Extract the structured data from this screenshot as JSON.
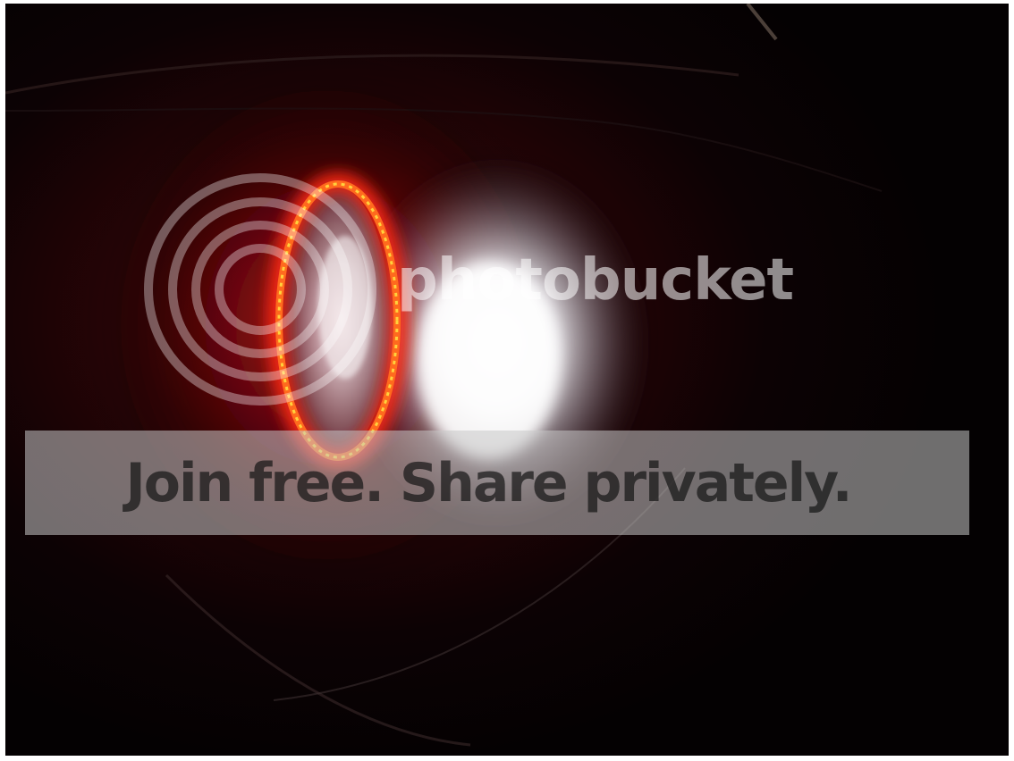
{
  "image": {
    "subject": "headlight-projector-halo-ring",
    "colors": {
      "background": "#050203",
      "halo_ring": "#ff2a14",
      "halo_inner": "#ffd23c",
      "beam": "#ffffff"
    }
  },
  "watermark": {
    "brand": "photobucket",
    "banner_text": "Join free. Share privately."
  }
}
